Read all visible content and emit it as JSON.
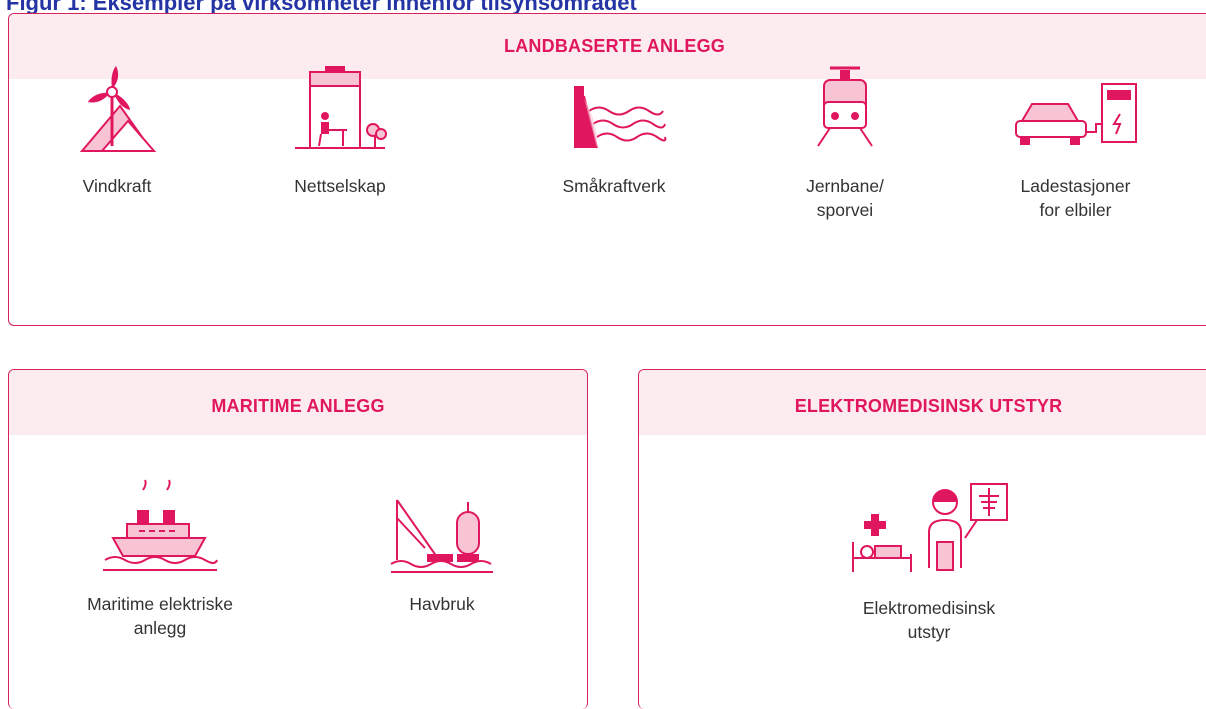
{
  "figure_title": "Figur 1: Eksempler på virksomheter innenfor tilsynsområdet",
  "colors": {
    "accent": "#e0175e",
    "border": "#d6205c",
    "header_fill": "#fdecef",
    "icon_fill": "#f8c3d3",
    "title": "#2434a4"
  },
  "panels": {
    "land": {
      "title": "LANDBASERTE ANLEGG",
      "items": [
        {
          "icon": "wind-turbine-icon",
          "label": "Vindkraft"
        },
        {
          "icon": "office-building-icon",
          "label": "Nettselskap"
        },
        {
          "icon": "hydropower-dam-icon",
          "label": "Småkraftverk"
        },
        {
          "icon": "train-icon",
          "label": "Jernbane/\nsporvei"
        },
        {
          "icon": "ev-charging-icon",
          "label": "Ladestasjoner\nfor elbiler"
        }
      ]
    },
    "maritime": {
      "title": "MARITIME ANLEGG",
      "items": [
        {
          "icon": "ship-icon",
          "label": "Maritime elektriske\nanlegg"
        },
        {
          "icon": "fish-farm-icon",
          "label": "Havbruk"
        }
      ]
    },
    "medical": {
      "title": "ELEKTROMEDISINSK UTSTYR",
      "items": [
        {
          "icon": "medical-equipment-icon",
          "label": "Elektromedisinsk\nutstyr"
        }
      ]
    }
  }
}
